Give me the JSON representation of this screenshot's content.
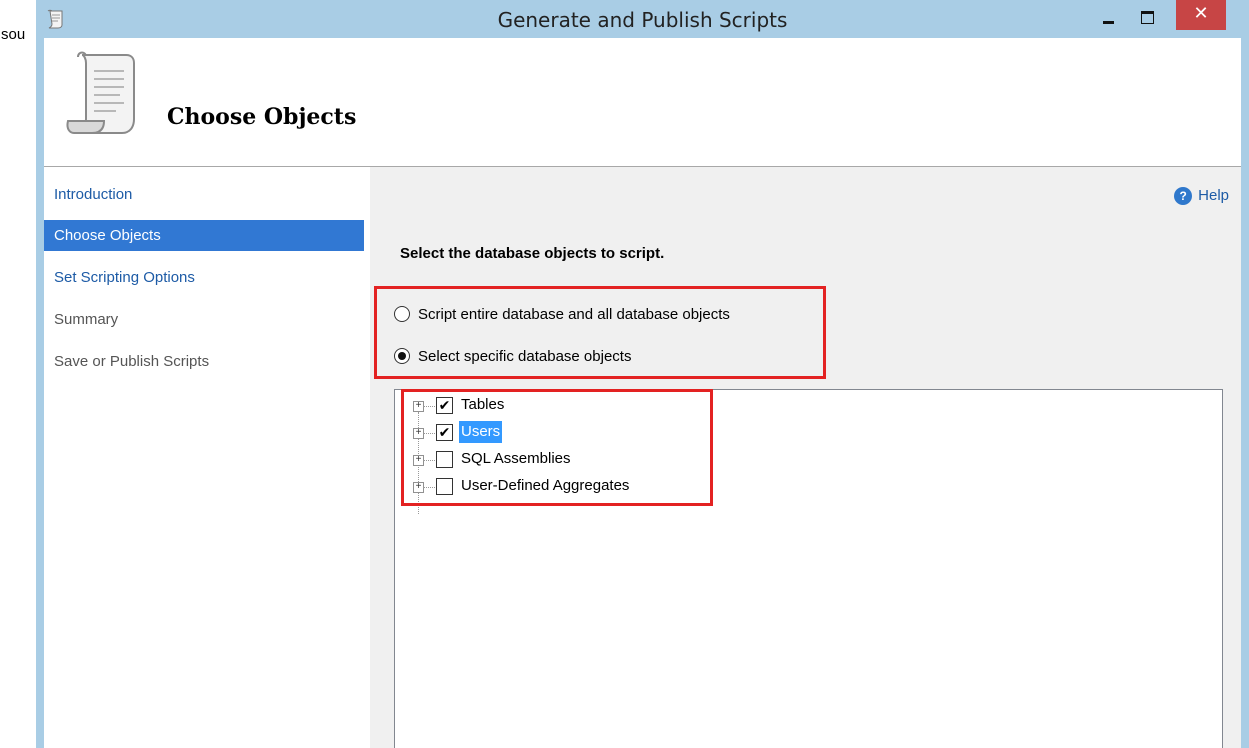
{
  "background_text": "sou",
  "window": {
    "title": "Generate and Publish Scripts",
    "close_glyph": "✕"
  },
  "header": {
    "title": "Choose Objects"
  },
  "nav": {
    "items": [
      {
        "label": "Introduction",
        "state": "link"
      },
      {
        "label": "Choose Objects",
        "state": "selected"
      },
      {
        "label": "Set Scripting Options",
        "state": "link"
      },
      {
        "label": "Summary",
        "state": "disabled"
      },
      {
        "label": "Save or Publish Scripts",
        "state": "disabled"
      }
    ]
  },
  "main": {
    "help_label": "Help",
    "instruction": "Select the database objects to script.",
    "options": [
      {
        "label": "Script entire database and all database objects",
        "checked": false
      },
      {
        "label": "Select specific database objects",
        "checked": true
      }
    ],
    "tree": [
      {
        "label": "Tables",
        "checked": true,
        "selected": false
      },
      {
        "label": "Users",
        "checked": true,
        "selected": true
      },
      {
        "label": "SQL Assemblies",
        "checked": false,
        "selected": false
      },
      {
        "label": "User-Defined Aggregates",
        "checked": false,
        "selected": false
      }
    ],
    "check_glyph": "✔",
    "expand_glyph": "+"
  },
  "colors": {
    "title_bar": "#a9cde5",
    "close_button": "#c74545",
    "nav_selected": "#3178d3",
    "link": "#1d5ba6",
    "highlight_box": "#e32222",
    "tree_selection": "#3399ff"
  },
  "icons": {
    "app": "scroll-icon",
    "header": "scroll-icon",
    "help": "help-icon",
    "minimize": "minimize-icon",
    "maximize": "maximize-icon",
    "close": "close-icon"
  }
}
